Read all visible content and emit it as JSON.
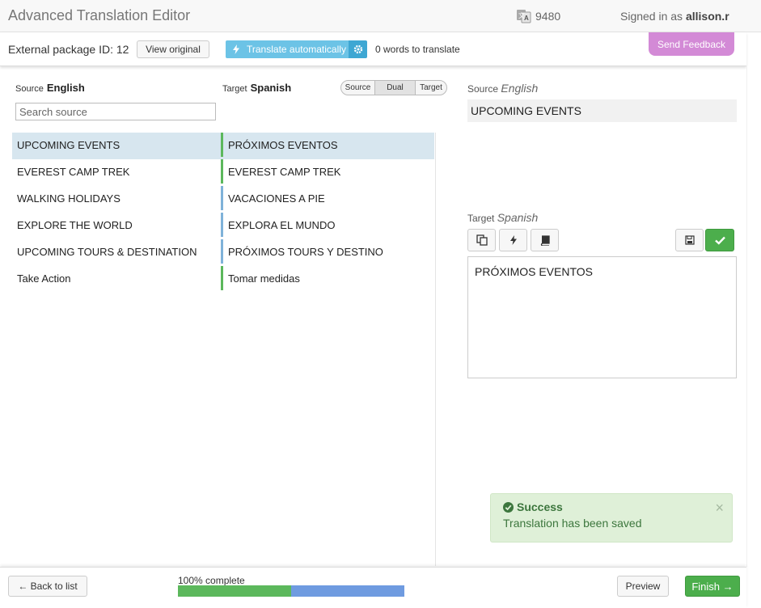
{
  "header": {
    "title": "Advanced Translation Editor",
    "credits": "9480",
    "signed_prefix": "Signed in as",
    "user": "allison.r"
  },
  "toolbar": {
    "package_id": "External package ID: 12",
    "view_original": "View original",
    "translate_auto": "Translate automatically",
    "words_to_translate": "0 words to translate",
    "send_feedback": "Send Feedback"
  },
  "languages": {
    "source_label": "Source",
    "source": "English",
    "target_label": "Target",
    "target": "Spanish"
  },
  "view_toggle": [
    "Source",
    "Dual",
    "Target"
  ],
  "search": {
    "placeholder": "Search source",
    "value": ""
  },
  "segments": [
    {
      "source": "UPCOMING EVENTS",
      "target": "PRÓXIMOS EVENTOS",
      "status_color": "#5cb85c",
      "active": true
    },
    {
      "source": "EVEREST CAMP TREK",
      "target": "EVEREST CAMP TREK",
      "status_color": "#5cb85c",
      "active": false
    },
    {
      "source": "WALKING HOLIDAYS",
      "target": "VACACIONES A PIE",
      "status_color": "#7fb2d9",
      "active": false
    },
    {
      "source": "EXPLORE THE WORLD",
      "target": "EXPLORA EL MUNDO",
      "status_color": "#7fb2d9",
      "active": false
    },
    {
      "source": "UPCOMING TOURS & DESTINATION",
      "target": "PRÓXIMOS TOURS Y DESTINO",
      "status_color": "#7fb2d9",
      "active": false
    },
    {
      "source": "Take Action",
      "target": "Tomar medidas",
      "status_color": "#5cb85c",
      "active": false
    }
  ],
  "editor": {
    "source_label": "Source",
    "source_lang": "English",
    "source_text": "UPCOMING EVENTS",
    "target_label": "Target",
    "target_lang": "Spanish",
    "target_text": "PRÓXIMOS EVENTOS"
  },
  "toast": {
    "title": "Success",
    "message": "Translation has been saved"
  },
  "footer": {
    "back": "← Back to list",
    "progress_label": "100% complete",
    "progress_green_fraction": 0.5,
    "progress_total_fraction": 1.0,
    "preview": "Preview",
    "finish": "Finish →"
  },
  "colors": {
    "accent_blue": "#6cc3e6",
    "success_green": "#5cb85c",
    "feedback_pink": "#d38ad6",
    "active_row": "#d7e6ef"
  }
}
